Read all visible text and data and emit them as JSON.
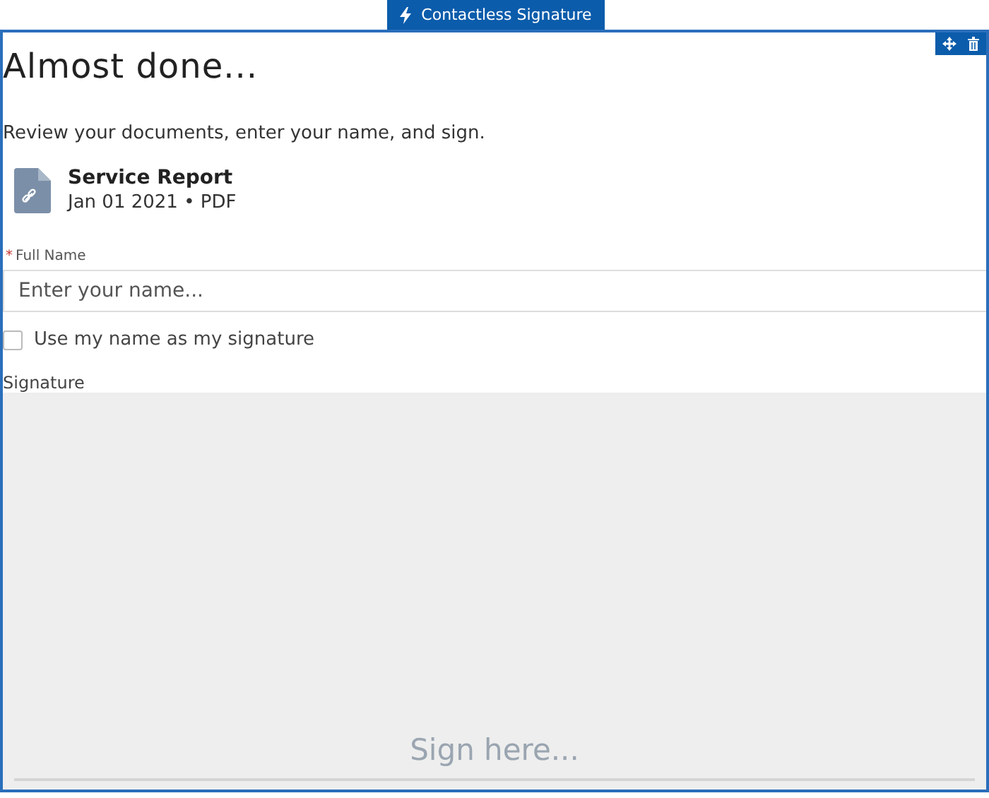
{
  "component_tab": {
    "label": "Contactless Signature"
  },
  "heading": "Almost done...",
  "instructions": "Review your documents, enter your name, and sign.",
  "document": {
    "title": "Service Report",
    "meta": "Jan 01 2021 • PDF"
  },
  "full_name": {
    "label": "Full Name",
    "required_mark": "*",
    "placeholder": "Enter your name..."
  },
  "use_name_checkbox": {
    "label": "Use my name as my signature",
    "checked": false
  },
  "signature": {
    "label": "Signature",
    "placeholder": "Sign here..."
  }
}
